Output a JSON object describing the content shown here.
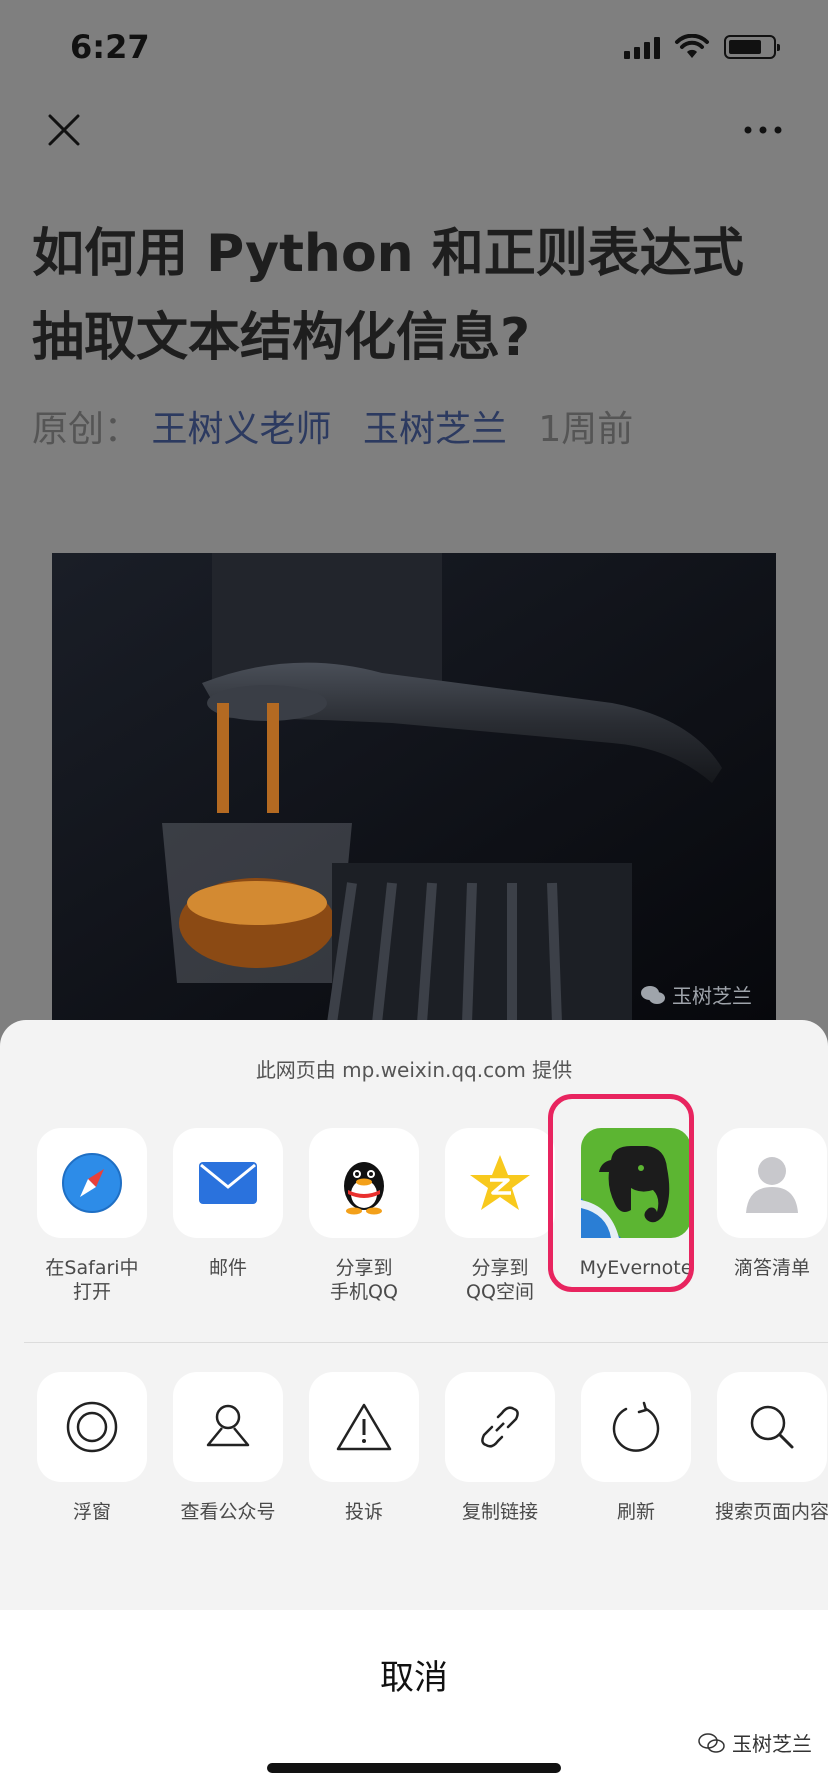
{
  "status_bar": {
    "time": "6:27"
  },
  "article": {
    "title": "如何用 Python 和正则表达式抽取文本结构化信息?",
    "meta_label": "原创：",
    "author": "王树义老师",
    "account": "玉树芝兰",
    "time_ago": "1周前",
    "image_watermark": "玉树芝兰"
  },
  "share_sheet": {
    "provider_text": "此网页由 mp.weixin.qq.com 提供",
    "apps": [
      {
        "label": "在Safari中\n打开",
        "icon": "safari-icon"
      },
      {
        "label": "邮件",
        "icon": "mail-icon"
      },
      {
        "label": "分享到\n手机QQ",
        "icon": "qq-icon"
      },
      {
        "label": "分享到\nQQ空间",
        "icon": "qzone-icon"
      },
      {
        "label": "MyEvernote",
        "icon": "evernote-icon"
      },
      {
        "label": "滴答清单",
        "icon": "person-icon"
      }
    ],
    "actions": [
      {
        "label": "浮窗",
        "icon": "floating-window-icon"
      },
      {
        "label": "查看公众号",
        "icon": "official-account-icon"
      },
      {
        "label": "投诉",
        "icon": "warning-icon"
      },
      {
        "label": "复制链接",
        "icon": "link-icon"
      },
      {
        "label": "刷新",
        "icon": "refresh-icon"
      },
      {
        "label": "搜索页面内容",
        "icon": "search-icon"
      }
    ],
    "cancel_label": "取消"
  },
  "corner_watermark": "玉树芝兰",
  "colors": {
    "highlight": "#e8245f",
    "evernote_green": "#5cb532",
    "dim_overlay": "#7f7f7f"
  }
}
